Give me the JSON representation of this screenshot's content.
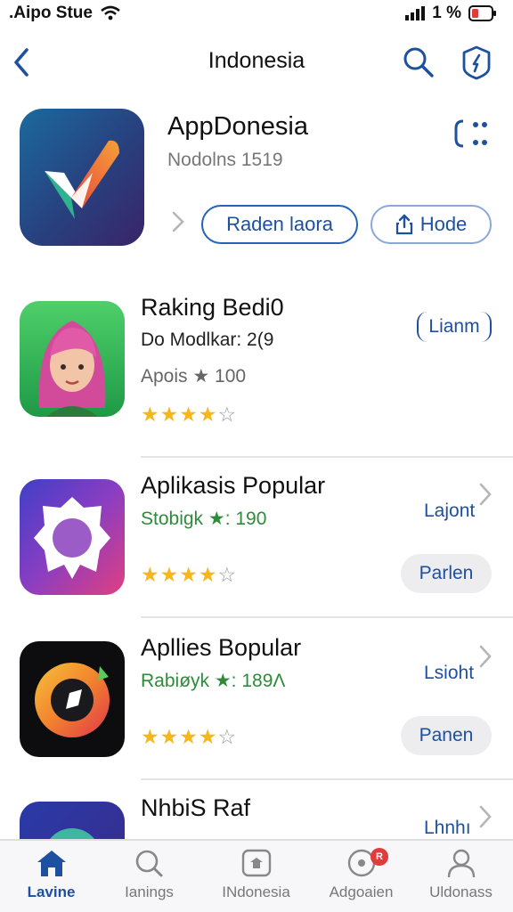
{
  "status_bar": {
    "carrier": ".Aipo Stue",
    "battery_percent": "1 %",
    "icons": [
      "wifi-icon",
      "signal-icon",
      "battery-icon"
    ]
  },
  "nav": {
    "title": "Indonesia",
    "icons": [
      "back-chevron-icon",
      "search-icon",
      "compass-icon"
    ]
  },
  "featured": {
    "title": "AppDonesia",
    "subtitle": "Nodolns 1519",
    "primary_button": "Raden laora",
    "secondary_button": "Hode",
    "icons": [
      "grid-icon",
      "share-icon",
      "chevron-right-icon"
    ]
  },
  "apps": [
    {
      "title": "Raking Bedi0",
      "meta": "Do Modlkar: 2(9",
      "sub": "Apois ★ 100",
      "rating": 4,
      "action_label": "Lianm"
    },
    {
      "title": "Aplikasis Popular",
      "meta": "Stobigk ★: 190",
      "rating": 4,
      "link_label": "Lajont",
      "button_label": "Parlen"
    },
    {
      "title": "Apllies Bopular",
      "meta": "Rabiøyk ★: 189Λ",
      "rating": 4,
      "link_label": "Lsioht",
      "button_label": "Panen"
    },
    {
      "title": "NhbiS Raf",
      "link_label": "Lhnhı"
    }
  ],
  "tabs": [
    {
      "label": "Lavine",
      "icon": "home-icon",
      "active": true
    },
    {
      "label": "Ianings",
      "icon": "search-icon"
    },
    {
      "label": "INdonesia",
      "icon": "apps-icon"
    },
    {
      "label": "Adgoaien",
      "icon": "updates-icon",
      "badge": "R"
    },
    {
      "label": "Uldonass",
      "icon": "account-icon"
    }
  ],
  "colors": {
    "accent": "#1e50a0",
    "star": "#f5b71a",
    "badge": "#e23b3b"
  }
}
